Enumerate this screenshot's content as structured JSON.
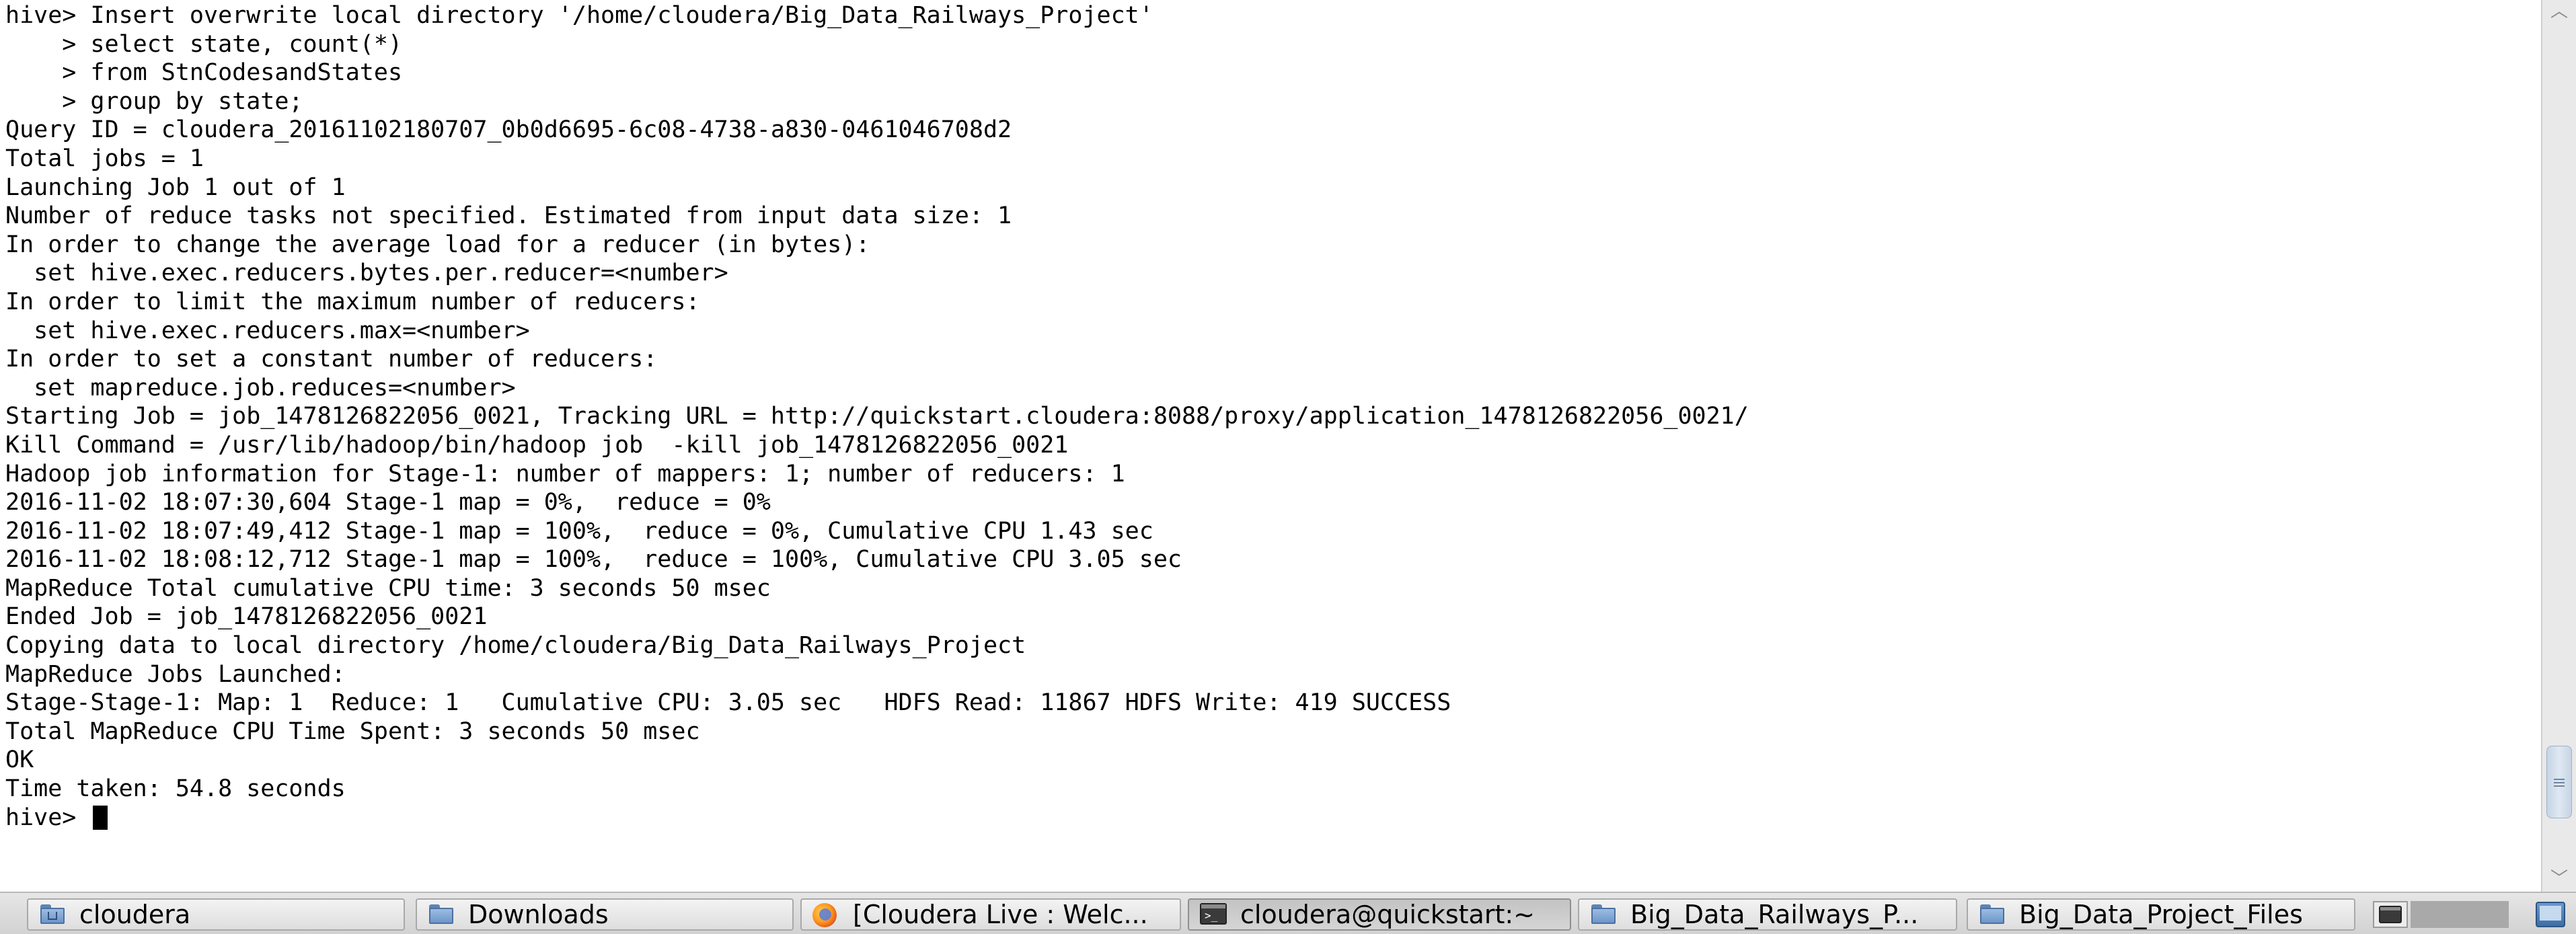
{
  "terminal": {
    "lines": [
      "hive> Insert overwrite local directory '/home/cloudera/Big_Data_Railways_Project'",
      "    > select state, count(*)",
      "    > from StnCodesandStates",
      "    > group by state;",
      "Query ID = cloudera_20161102180707_0b0d6695-6c08-4738-a830-0461046708d2",
      "Total jobs = 1",
      "Launching Job 1 out of 1",
      "Number of reduce tasks not specified. Estimated from input data size: 1",
      "In order to change the average load for a reducer (in bytes):",
      "  set hive.exec.reducers.bytes.per.reducer=<number>",
      "In order to limit the maximum number of reducers:",
      "  set hive.exec.reducers.max=<number>",
      "In order to set a constant number of reducers:",
      "  set mapreduce.job.reduces=<number>",
      "Starting Job = job_1478126822056_0021, Tracking URL = http://quickstart.cloudera:8088/proxy/application_1478126822056_0021/",
      "Kill Command = /usr/lib/hadoop/bin/hadoop job  -kill job_1478126822056_0021",
      "Hadoop job information for Stage-1: number of mappers: 1; number of reducers: 1",
      "2016-11-02 18:07:30,604 Stage-1 map = 0%,  reduce = 0%",
      "2016-11-02 18:07:49,412 Stage-1 map = 100%,  reduce = 0%, Cumulative CPU 1.43 sec",
      "2016-11-02 18:08:12,712 Stage-1 map = 100%,  reduce = 100%, Cumulative CPU 3.05 sec",
      "MapReduce Total cumulative CPU time: 3 seconds 50 msec",
      "Ended Job = job_1478126822056_0021",
      "Copying data to local directory /home/cloudera/Big_Data_Railways_Project",
      "MapReduce Jobs Launched:",
      "Stage-Stage-1: Map: 1  Reduce: 1   Cumulative CPU: 3.05 sec   HDFS Read: 11867 HDFS Write: 419 SUCCESS",
      "Total MapReduce CPU Time Spent: 3 seconds 50 msec",
      "OK",
      "Time taken: 54.8 seconds"
    ],
    "prompt": "hive> "
  },
  "scrollbar": {
    "position": 0.94
  },
  "taskbar": {
    "items": [
      {
        "label": "cloudera",
        "icon": "folder-home-icon",
        "active": false
      },
      {
        "label": "Downloads",
        "icon": "folder-icon",
        "active": false
      },
      {
        "label": "[Cloudera Live : Welc...",
        "icon": "firefox-icon",
        "active": false
      },
      {
        "label": "cloudera@quickstart:~",
        "icon": "terminal-icon",
        "active": true
      },
      {
        "label": "Big_Data_Railways_P...",
        "icon": "folder-icon",
        "active": false
      },
      {
        "label": "Big_Data_Project_Files",
        "icon": "folder-icon",
        "active": false
      }
    ],
    "tray": {
      "terminal_icon": "terminal-icon",
      "desktop_icon": "show-desktop-icon"
    }
  }
}
